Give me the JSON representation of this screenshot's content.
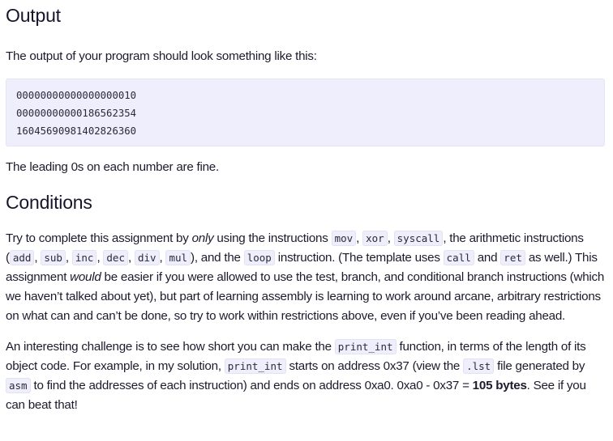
{
  "sections": {
    "output": {
      "heading": "Output",
      "intro": "The output of your program should look something like this:",
      "code_lines": [
        "00000000000000000010",
        "00000000000186562354",
        "16045690981402826360"
      ],
      "note": "The leading 0s on each number are fine."
    },
    "conditions": {
      "heading": "Conditions",
      "para1": {
        "t1": "Try to complete this assignment by ",
        "em1": "only",
        "t2": " using the instructions ",
        "c_mov": "mov",
        "sep1": ", ",
        "c_xor": "xor",
        "sep2": ", ",
        "c_syscall": "syscall",
        "t3": ", the arithmetic instructions (",
        "c_add": "add",
        "sep3": ", ",
        "c_sub": "sub",
        "sep4": ", ",
        "c_inc": "inc",
        "sep5": ", ",
        "c_dec": "dec",
        "sep6": ", ",
        "c_div": "div",
        "sep7": ", ",
        "c_mul": "mul",
        "t4": "), and the ",
        "c_loop": "loop",
        "t5": " instruction. (The template uses ",
        "c_call": "call",
        "t6": " and ",
        "c_ret": "ret",
        "t7": " as well.) This assignment ",
        "em2": "would",
        "t8": " be easier if you were allowed to use the test, branch, and conditional branch instructions (which we haven’t talked about yet), but part of learning assembly is learning to work around arcane, arbitrary restrictions on what can and can’t be done, so try to work within restrictions above, even if you’ve been reading ahead."
      },
      "para2": {
        "t1": "An interesting challenge is to see how short you can make the ",
        "c_print_int_1": "print_int",
        "t2": " function, in terms of the length of its object code. For example, in my solution, ",
        "c_print_int_2": "print_int",
        "t3": " starts on address 0x37 (view the ",
        "c_lst": ".lst",
        "t4": " file generated by ",
        "c_asm": "asm",
        "t5": " to find the addresses of each instruction) and ends on address 0xa0. 0xa0 - 0x37 = ",
        "strong1": "105 bytes",
        "t6": ". See if you can beat that!"
      }
    }
  }
}
